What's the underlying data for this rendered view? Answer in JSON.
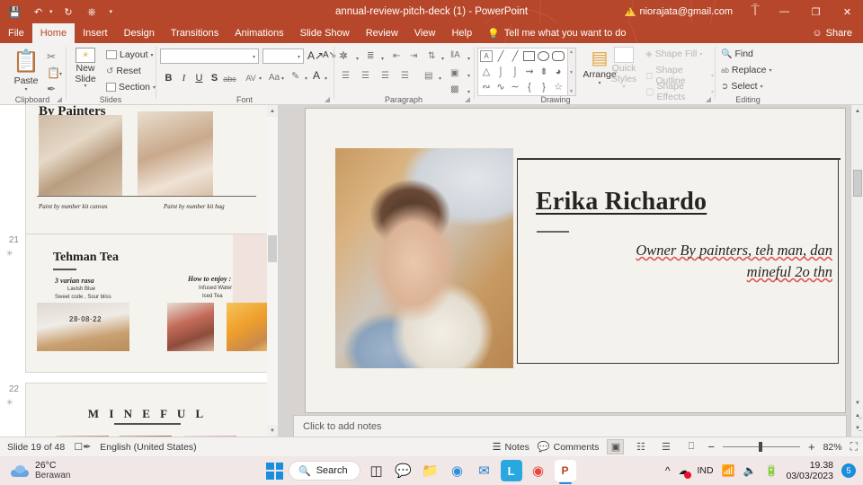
{
  "titlebar": {
    "document_title": "annual-review-pitch-deck (1)  -  PowerPoint",
    "account": "niorajata@gmail.com",
    "warning_icon": "warning-triangle-icon",
    "quick_access": [
      {
        "name": "save-icon",
        "glyph": "💾"
      },
      {
        "name": "undo-icon",
        "glyph": "↶"
      },
      {
        "name": "redo-icon",
        "glyph": "↻"
      },
      {
        "name": "start-presentation-icon",
        "glyph": "⎘"
      },
      {
        "name": "customize-quick-access-toolbar-icon",
        "glyph": "▾"
      }
    ],
    "window_controls": [
      {
        "name": "ribbon-display-options-button",
        "glyph": "⬚"
      },
      {
        "name": "minimize-button",
        "glyph": "—"
      },
      {
        "name": "restore-button",
        "glyph": "❐"
      },
      {
        "name": "close-button",
        "glyph": "✕"
      }
    ]
  },
  "tabs": [
    {
      "label": "File",
      "active": false
    },
    {
      "label": "Home",
      "active": true
    },
    {
      "label": "Insert",
      "active": false
    },
    {
      "label": "Design",
      "active": false
    },
    {
      "label": "Transitions",
      "active": false
    },
    {
      "label": "Animations",
      "active": false
    },
    {
      "label": "Slide Show",
      "active": false
    },
    {
      "label": "Review",
      "active": false
    },
    {
      "label": "View",
      "active": false
    },
    {
      "label": "Help",
      "active": false
    }
  ],
  "tellme": {
    "label": "Tell me what you want to do",
    "icon": "lightbulb-icon"
  },
  "share": {
    "label": "Share",
    "icon": "share-person-icon"
  },
  "ribbon": {
    "clipboard": {
      "group_label": "Clipboard",
      "paste_label": "Paste",
      "cut_icon": "scissors-icon",
      "copy_icon": "copy-icon",
      "format_painter_icon": "format-painter-icon"
    },
    "slides": {
      "group_label": "Slides",
      "new_slide_label": "New Slide",
      "layout_label": "Layout",
      "reset_label": "Reset",
      "section_label": "Section"
    },
    "font": {
      "group_label": "Font",
      "font_name_value": "",
      "font_name_placeholder": "",
      "font_size_value": "",
      "font_size_placeholder": "",
      "buttons": [
        "B",
        "I",
        "U",
        "S",
        "abc",
        "AV",
        "Aa"
      ],
      "increase_font_icon": "increase-font-size-icon",
      "decrease_font_icon": "decrease-font-size-icon",
      "clear_formatting_icon": "clear-formatting-icon",
      "text_highlight_icon": "text-highlight-color-icon",
      "font_color_icon": "font-color-icon"
    },
    "paragraph": {
      "group_label": "Paragraph",
      "bullets_icon": "bullets-icon",
      "numbering_icon": "numbering-icon",
      "decrease_indent_icon": "decrease-indent-icon",
      "increase_indent_icon": "increase-indent-icon",
      "line_spacing_icon": "line-spacing-icon",
      "text_direction_icon": "text-direction-icon",
      "align_text_icon": "align-text-icon",
      "convert_to_smartart_icon": "convert-to-smartart-icon",
      "align_left_icon": "align-left-icon",
      "align_center_icon": "align-center-icon",
      "align_right_icon": "align-right-icon",
      "justify_icon": "justify-icon",
      "columns_icon": "columns-icon"
    },
    "drawing": {
      "group_label": "Drawing",
      "arrange_label": "Arrange",
      "quick_styles_label": "Quick Styles",
      "shape_fill_label": "Shape Fill",
      "shape_outline_label": "Shape Outline",
      "shape_effects_label": "Shape Effects",
      "shapes": [
        "A",
        "line",
        "arrow",
        "rect",
        "oval",
        "round-rect",
        "triangle",
        "elbow",
        "elbow2",
        "block-arrow",
        "down-arrow",
        "pie",
        "scribble",
        "curve",
        "wave",
        "left-brace",
        "right-brace",
        "star"
      ]
    },
    "editing": {
      "group_label": "Editing",
      "find_label": "Find",
      "replace_label": "Replace",
      "select_label": "Select",
      "find_icon": "magnifier-icon",
      "replace_icon": "replace-icon",
      "select_icon": "select-arrow-icon"
    }
  },
  "thumbnails": {
    "items": [
      {
        "number": "",
        "selected": false,
        "title": "By Painters",
        "caption_left": "Paint by number kit canvas",
        "caption_right": "Paint by number kit bag"
      },
      {
        "number": "21",
        "selected": false,
        "title": "Tehman Tea",
        "sub_left_head": "3 varian rasa",
        "sub_left_1": "Lavish Blue",
        "sub_left_2": "Sweet code , Sour bliss",
        "sub_right_head": "How to enjoy :",
        "sub_right_1": "Infused Water",
        "sub_right_2": "Iced Tea",
        "date_stamp": "28·08·22"
      },
      {
        "number": "22",
        "selected": false,
        "title": "M I N E F U L"
      }
    ],
    "star_marker": "✳"
  },
  "slide": {
    "name": "Erika Richardo",
    "role_line1": "Owner By painters, teh man, dan",
    "role_line2": "mineful 2o thn",
    "spellcheck_words": [
      "Owner",
      "painters",
      "man",
      "mineful"
    ],
    "photo_alt": "person-photo"
  },
  "notes": {
    "placeholder": "Click to add notes"
  },
  "statusbar": {
    "slide_counter": "Slide 19 of 48",
    "accessibility_icon": "accessibility-check-icon",
    "language": "English (United States)",
    "notes_label": "Notes",
    "comments_label": "Comments",
    "notes_icon": "notes-icon",
    "comments_icon": "comment-bubble-icon",
    "views": [
      {
        "name": "normal-view-button",
        "glyph": "▣",
        "active": true
      },
      {
        "name": "slide-sorter-view-button",
        "glyph": "☷",
        "active": false
      },
      {
        "name": "reading-view-button",
        "glyph": "⌸",
        "active": false
      },
      {
        "name": "slide-show-button",
        "glyph": "⎙",
        "active": false
      }
    ],
    "zoom_out": "−",
    "zoom_in": "+",
    "zoom_value": "82%",
    "fit_slide_icon": "fit-slide-to-window-icon"
  },
  "taskbar": {
    "weather_temp": "26°C",
    "weather_desc": "Berawan",
    "weather_icon": "cloud-icon",
    "start_icon": "windows-start-icon",
    "search_label": "Search",
    "search_icon": "magnifier-icon",
    "apps": [
      {
        "name": "taskbar-app-widgets",
        "glyph": "◧",
        "color": "#2b2b2b",
        "active": false
      },
      {
        "name": "taskbar-app-chat",
        "glyph": "📹",
        "color": "#8a5cf5",
        "active": false
      },
      {
        "name": "taskbar-app-file-explorer",
        "glyph": "📁",
        "color": "#f7b32b",
        "active": false
      },
      {
        "name": "taskbar-app-edge",
        "glyph": "◔",
        "color": "#2b8fd9",
        "active": false
      },
      {
        "name": "taskbar-app-mail",
        "glyph": "✉",
        "color": "#1e7fd4",
        "active": false
      },
      {
        "name": "taskbar-app-l",
        "glyph": "L",
        "color": "#29a8e0",
        "active": false
      },
      {
        "name": "taskbar-app-chrome",
        "glyph": "◉",
        "color": "#e8453c",
        "active": false
      },
      {
        "name": "taskbar-app-powerpoint",
        "glyph": "P",
        "color": "#c43e1c",
        "active": true
      }
    ],
    "tray": {
      "chevron_icon": "show-hidden-icons-chevron",
      "onedrive_icon": "onedrive-error-icon",
      "keyboard_layout": "IND",
      "wifi_icon": "wifi-icon",
      "volume_icon": "volume-icon",
      "battery_icon": "battery-charging-icon",
      "time": "19.38",
      "date": "03/03/2023",
      "notification_count": "5"
    }
  }
}
